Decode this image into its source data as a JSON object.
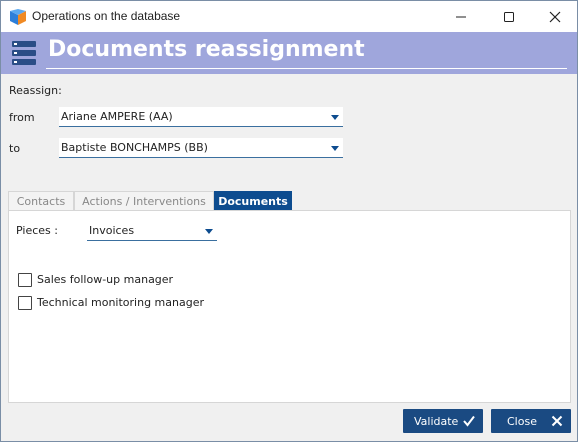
{
  "window": {
    "title": "Operations on the database",
    "controls": [
      "minimize-icon",
      "maximize-icon",
      "close-icon"
    ]
  },
  "header": {
    "title": "Documents reassignment",
    "icon": "database-icon",
    "background": "#9fa6dc"
  },
  "form": {
    "section_label": "Reassign:",
    "from_label": "from",
    "from_value": "Ariane AMPERE (AA)",
    "to_label": "to",
    "to_value": "Baptiste BONCHAMPS (BB)"
  },
  "tabs": [
    {
      "label": "Contacts",
      "active": false
    },
    {
      "label": "Actions / Interventions",
      "active": false
    },
    {
      "label": "Documents",
      "active": true
    }
  ],
  "documents": {
    "pieces_label": "Pieces :",
    "pieces_value": "Invoices",
    "checkboxes": [
      {
        "label": "Sales follow-up manager",
        "checked": false
      },
      {
        "label": "Technical monitoring manager",
        "checked": false
      }
    ]
  },
  "buttons": {
    "validate_label": "Validate",
    "close_label": "Close"
  },
  "colors": {
    "accent": "#0d4c8f",
    "button": "#1a4a82",
    "header": "#9fa6dc"
  }
}
